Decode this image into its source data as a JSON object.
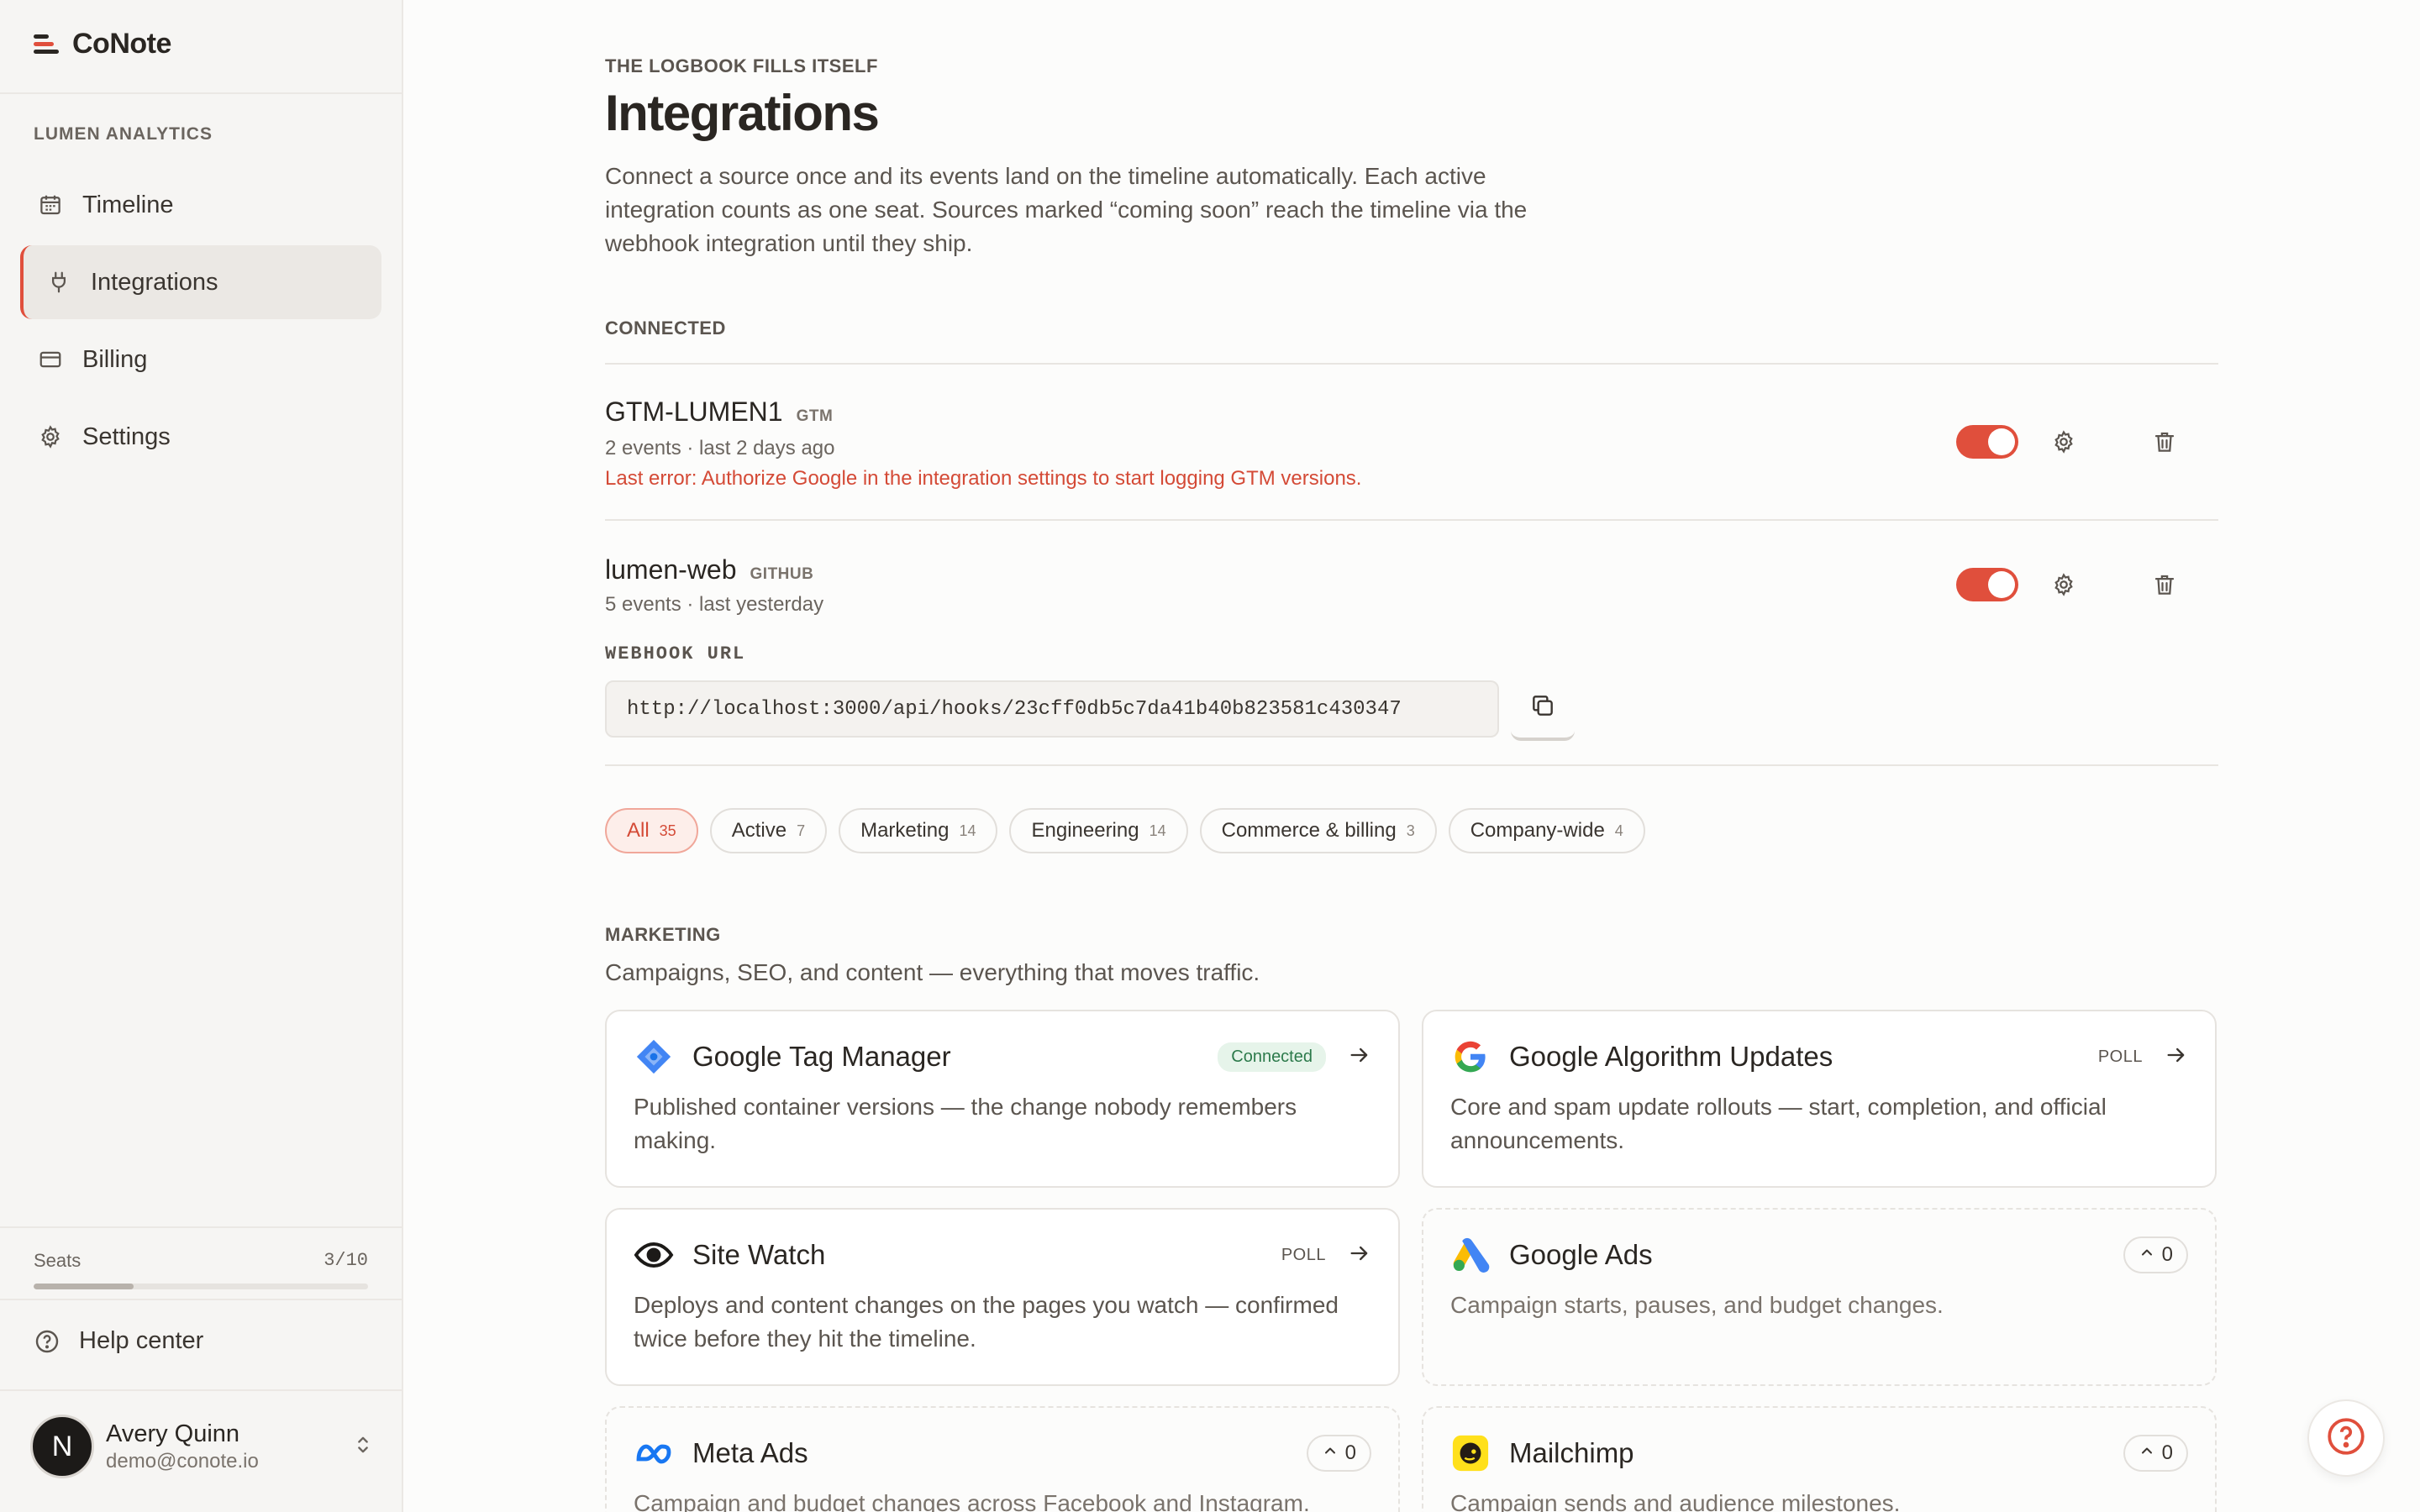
{
  "brand": {
    "name": "CoNote"
  },
  "sidebar": {
    "workspace": "LUMEN ANALYTICS",
    "items": [
      {
        "label": "Timeline",
        "icon": "calendar-icon"
      },
      {
        "label": "Integrations",
        "icon": "plug-icon",
        "active": true
      },
      {
        "label": "Billing",
        "icon": "credit-card-icon"
      },
      {
        "label": "Settings",
        "icon": "gear-icon"
      }
    ],
    "seats": {
      "label": "Seats",
      "count": "3/10",
      "used_fraction": 0.3
    },
    "help": "Help center",
    "user": {
      "initial": "N",
      "name": "Avery Quinn",
      "email": "demo@conote.io"
    }
  },
  "page": {
    "eyebrow": "THE LOGBOOK FILLS ITSELF",
    "title": "Integrations",
    "description": "Connect a source once and its events land on the timeline automatically. Each active integration counts as one seat. Sources marked “coming soon” reach the timeline via the webhook integration until they ship."
  },
  "connected": {
    "label": "CONNECTED",
    "items": [
      {
        "name": "GTM-LUMEN1",
        "tag": "GTM",
        "meta": "2 events · last 2 days ago",
        "error": "Last error: Authorize Google in the integration settings to start logging GTM versions.",
        "enabled": true
      },
      {
        "name": "lumen-web",
        "tag": "GITHUB",
        "meta": "5 events · last yesterday",
        "enabled": true,
        "webhook_label": "WEBHOOK URL",
        "webhook_url": "http://localhost:3000/api/hooks/23cff0db5c7da41b40b823581c430347"
      }
    ]
  },
  "filters": [
    {
      "label": "All",
      "count": "35",
      "active": true
    },
    {
      "label": "Active",
      "count": "7"
    },
    {
      "label": "Marketing",
      "count": "14"
    },
    {
      "label": "Engineering",
      "count": "14"
    },
    {
      "label": "Commerce & billing",
      "count": "3"
    },
    {
      "label": "Company-wide",
      "count": "4"
    }
  ],
  "marketing": {
    "label": "MARKETING",
    "subtitle": "Campaigns, SEO, and content — everything that moves traffic.",
    "cards": [
      {
        "title": "Google Tag Manager",
        "badge": "Connected",
        "desc": "Published container versions — the change nobody remembers making.",
        "icon": "gtm-icon"
      },
      {
        "title": "Google Algorithm Updates",
        "badge": "POLL",
        "desc": "Core and spam update rollouts — start, completion, and official announcements.",
        "icon": "google-icon"
      },
      {
        "title": "Site Watch",
        "badge": "POLL",
        "desc": "Deploys and content changes on the pages you watch — confirmed twice before they hit the timeline.",
        "icon": "eye-icon"
      },
      {
        "title": "Google Ads",
        "votes": "0",
        "desc": "Campaign starts, pauses, and budget changes.",
        "icon": "google-ads-icon"
      },
      {
        "title": "Meta Ads",
        "votes": "0",
        "desc": "Campaign and budget changes across Facebook and Instagram.",
        "icon": "meta-icon"
      },
      {
        "title": "Mailchimp",
        "votes": "0",
        "desc": "Campaign sends and audience milestones.",
        "icon": "mailchimp-icon"
      }
    ]
  },
  "colors": {
    "accent": "#e04f3c",
    "connected": "#2c7a4b"
  }
}
